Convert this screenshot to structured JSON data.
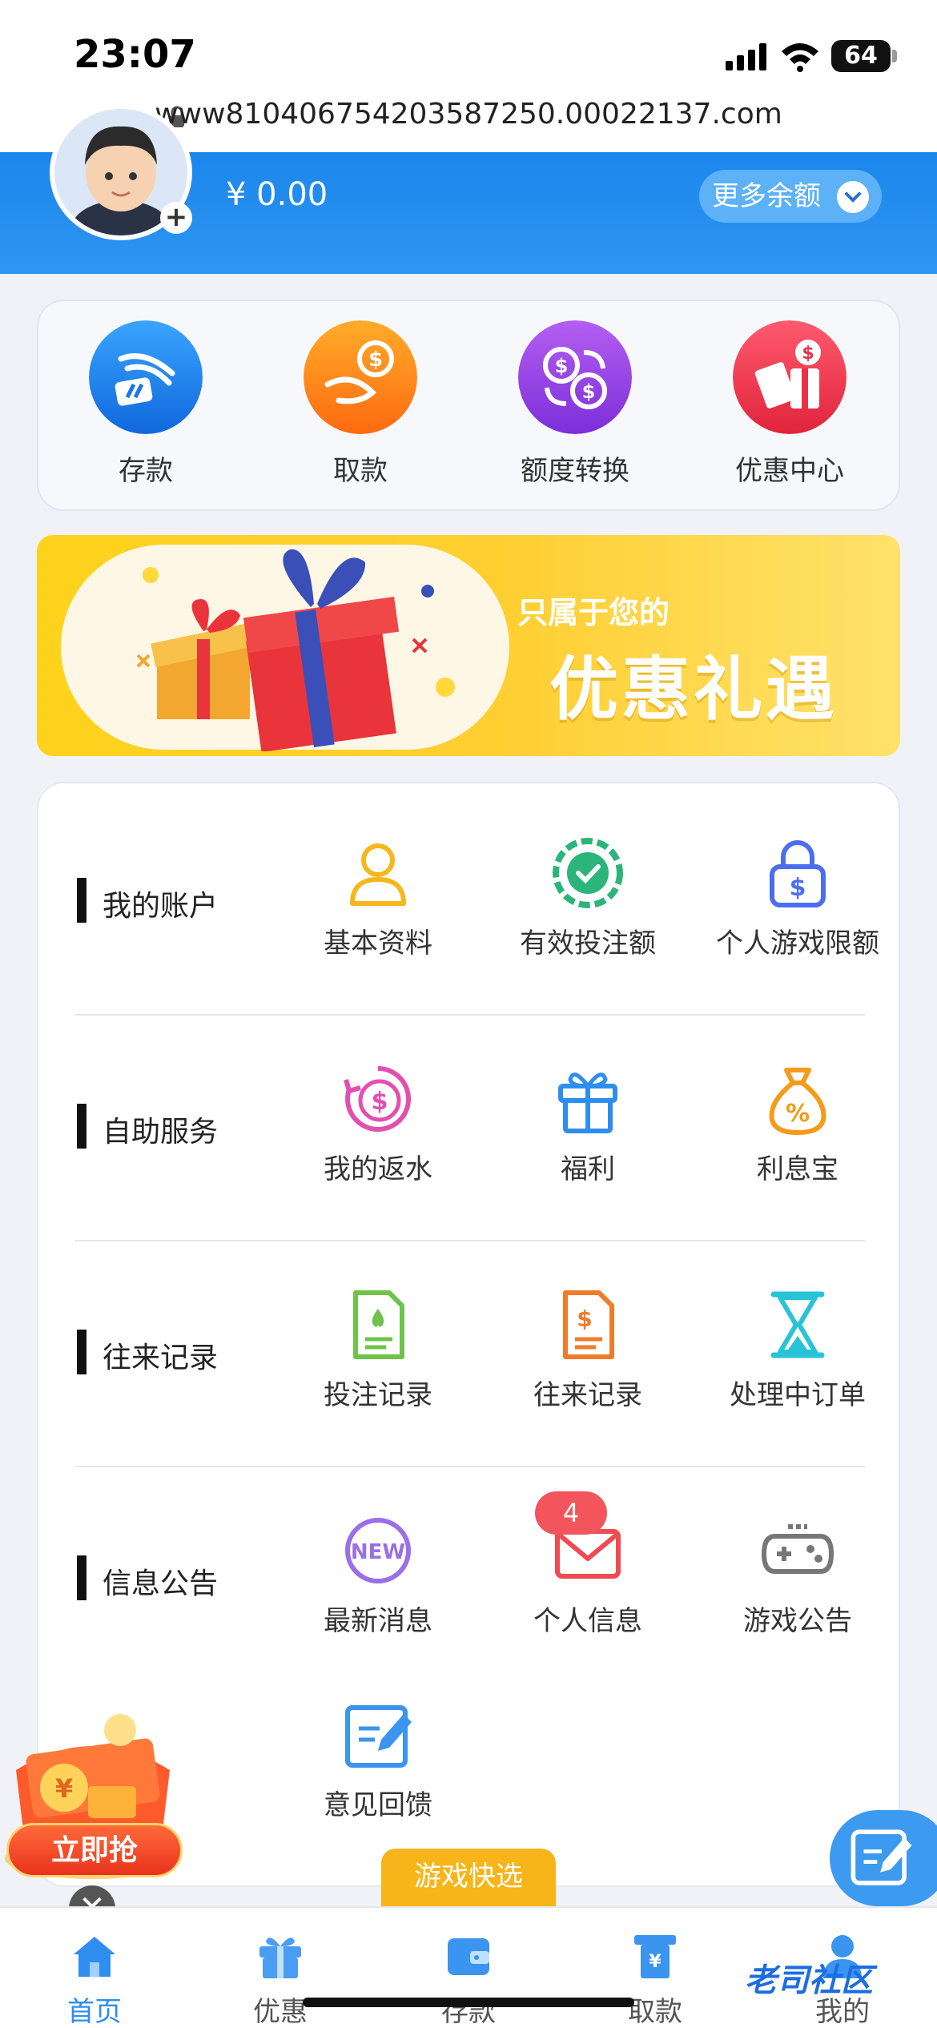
{
  "status_bar": {
    "time": "23:07",
    "battery": "64"
  },
  "browser": {
    "url": "www810406754203587250.00022137.com"
  },
  "header": {
    "balance": "¥ 0.00",
    "more_balance": "更多余额"
  },
  "quick_actions": [
    {
      "label": "存款",
      "icon": "deposit-icon",
      "color": "#1a8cf0"
    },
    {
      "label": "取款",
      "icon": "withdraw-icon",
      "color": "#ff8a1a"
    },
    {
      "label": "额度转换",
      "icon": "transfer-icon",
      "color": "#9b3ee6"
    },
    {
      "label": "优惠中心",
      "icon": "promo-center-icon",
      "color": "#f03a52"
    }
  ],
  "banner": {
    "subtitle": "只属于您的",
    "title": "优惠礼遇"
  },
  "sections": [
    {
      "title": "我的账户",
      "items": [
        {
          "label": "基本资料",
          "icon": "user-icon",
          "color": "#f5b81c"
        },
        {
          "label": "有效投注额",
          "icon": "chip-check-icon",
          "color": "#2bb57a"
        },
        {
          "label": "个人游戏限额",
          "icon": "lock-dollar-icon",
          "color": "#4b6ef0"
        }
      ]
    },
    {
      "title": "自助服务",
      "items": [
        {
          "label": "我的返水",
          "icon": "rebate-icon",
          "color": "#e34fb0"
        },
        {
          "label": "福利",
          "icon": "gift-icon",
          "color": "#2f8df0"
        },
        {
          "label": "利息宝",
          "icon": "money-bag-icon",
          "color": "#f59b1a"
        }
      ]
    },
    {
      "title": "往来记录",
      "items": [
        {
          "label": "投注记录",
          "icon": "bet-record-icon",
          "color": "#6fc24a"
        },
        {
          "label": "往来记录",
          "icon": "transaction-record-icon",
          "color": "#f07b2a"
        },
        {
          "label": "处理中订单",
          "icon": "hourglass-icon",
          "color": "#28c3d6"
        }
      ]
    },
    {
      "title": "信息公告",
      "items": [
        {
          "label": "最新消息",
          "icon": "new-badge-icon",
          "color": "#9b6fe6"
        },
        {
          "label": "个人信息",
          "icon": "mail-icon",
          "color": "#f04a52",
          "badge": "4"
        },
        {
          "label": "游戏公告",
          "icon": "gamepad-icon",
          "color": "#777777"
        }
      ]
    },
    {
      "title": "",
      "items": [
        {
          "label": "意见回馈",
          "icon": "feedback-edit-icon",
          "color": "#3a94f0"
        }
      ]
    }
  ],
  "floating": {
    "promo_button": "立即抢",
    "close": "✕",
    "quick_pick": "游戏快选"
  },
  "bottom_nav": [
    {
      "label": "首页",
      "icon": "home-icon",
      "active": true
    },
    {
      "label": "优惠",
      "icon": "gift-icon"
    },
    {
      "label": "存款",
      "icon": "wallet-icon"
    },
    {
      "label": "取款",
      "icon": "withdraw-atm-icon"
    },
    {
      "label": "我的",
      "icon": "profile-icon"
    }
  ],
  "watermark": "老司社区"
}
